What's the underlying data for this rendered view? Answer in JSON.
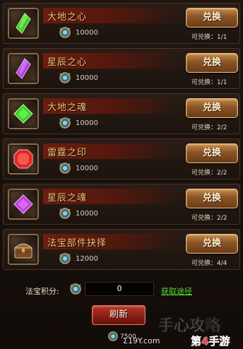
{
  "items": [
    {
      "name": "大地之心",
      "cost": "10000",
      "button": "兑换",
      "exchangeable": "可兑换：1/1",
      "gem": "green-crystal-icon",
      "color": "#3ac628"
    },
    {
      "name": "星辰之心",
      "cost": "10000",
      "button": "兑换",
      "exchangeable": "可兑换：1/1",
      "gem": "purple-crystal-icon",
      "color": "#b23ae0"
    },
    {
      "name": "大地之魂",
      "cost": "10000",
      "button": "兑换",
      "exchangeable": "可兑换：2/2",
      "gem": "green-gem-icon",
      "color": "#34d028"
    },
    {
      "name": "雷霆之印",
      "cost": "10000",
      "button": "兑换",
      "exchangeable": "可兑换：2/2",
      "gem": "red-gem-icon",
      "color": "#e02828"
    },
    {
      "name": "星辰之魂",
      "cost": "10000",
      "button": "兑换",
      "exchangeable": "可兑换：2/2",
      "gem": "purple-gem-icon",
      "color": "#c03ae0"
    },
    {
      "name": "法宝部件抉择",
      "cost": "12000",
      "button": "兑换",
      "exchangeable": "可兑换：4/4",
      "gem": "treasure-chest-icon",
      "color": "#a87444"
    }
  ],
  "footer": {
    "points_label": "法宝积分:",
    "points_value": "0",
    "get_link": "获取途径",
    "refresh_label": "刷新",
    "refresh_cost": "7500"
  },
  "watermark": {
    "text": "手心攻略",
    "sub": "第4手游",
    "url": "Σ19Y.com"
  },
  "colors": {
    "accent_gold": "#f0c878",
    "button_brown": "#8a5426",
    "refresh_red": "#8a1e14",
    "link_green": "#58d838"
  }
}
